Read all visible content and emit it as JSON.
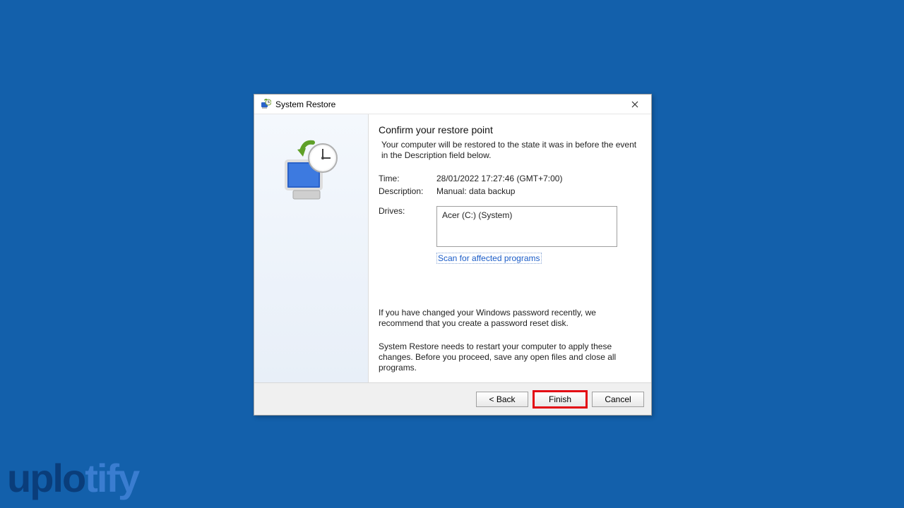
{
  "titlebar": {
    "title": "System Restore"
  },
  "content": {
    "heading": "Confirm your restore point",
    "intro": "Your computer will be restored to the state it was in before the event in the Description field below.",
    "time_label": "Time:",
    "time_value": "28/01/2022 17:27:46 (GMT+7:00)",
    "description_label": "Description:",
    "description_value": "Manual: data backup",
    "drives_label": "Drives:",
    "drives_value": "Acer (C:) (System)",
    "scan_link": "Scan for affected programs",
    "note1": "If you have changed your Windows password recently, we recommend that you create a password reset disk.",
    "note2": "System Restore needs to restart your computer to apply these changes. Before you proceed, save any open files and close all programs."
  },
  "buttons": {
    "back": "< Back",
    "finish": "Finish",
    "cancel": "Cancel"
  },
  "watermark": {
    "part1": "uplo",
    "part2": "tify"
  }
}
